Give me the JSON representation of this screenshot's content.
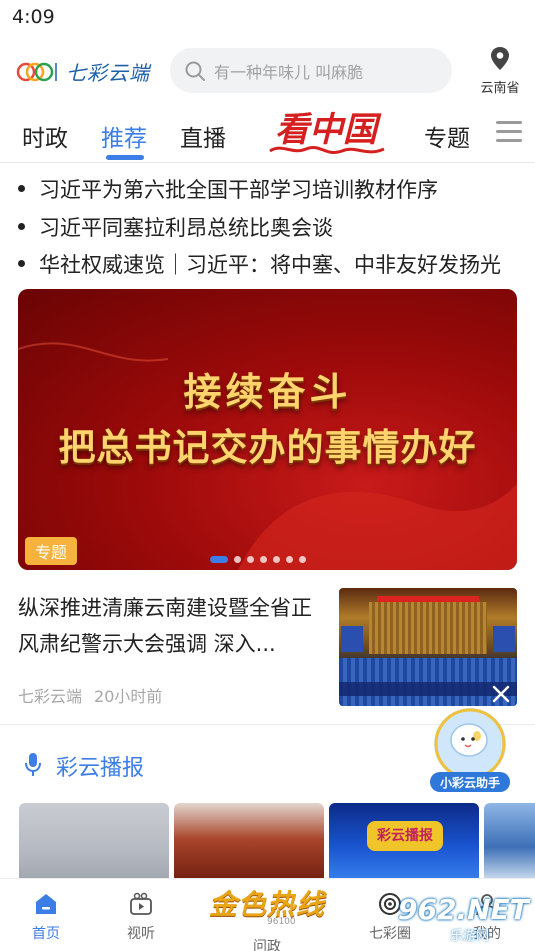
{
  "status_bar": {
    "time": "4:09"
  },
  "header": {
    "logo_text": "七彩云端",
    "search_placeholder": "有一种年味儿 叫麻脆",
    "location": "云南省"
  },
  "tabs": [
    {
      "label": "时政",
      "active": false
    },
    {
      "label": "推荐",
      "active": true
    },
    {
      "label": "直播",
      "active": false
    },
    {
      "label": "专题",
      "active": false
    }
  ],
  "center_tab_logo": "看中国",
  "headlines": [
    "习近平为第六批全国干部学习培训教材作序",
    "习近平同塞拉利昂总统比奥会谈",
    "华社权威速览｜习近平：将中塞、中非友好发扬光"
  ],
  "banner": {
    "line1": "接续奋斗",
    "line2": "把总书记交办的事情办好",
    "tag": "专题",
    "slide_count": 7,
    "active_slide": 0
  },
  "article": {
    "title": "纵深推进清廉云南建设暨全省正风肃纪警示大会强调 深入...",
    "source": "七彩云端",
    "time": "20小时前"
  },
  "assistant_label": "小彩云助手",
  "broadcast": {
    "title": "彩云播报",
    "thumb_badge": "彩云播报"
  },
  "bottom_nav": {
    "items": [
      {
        "label": "首页",
        "icon": "home-icon",
        "active": true
      },
      {
        "label": "视听",
        "icon": "video-icon",
        "active": false
      },
      {
        "label": "问政",
        "icon": "golden-hotline-logo",
        "active": false
      },
      {
        "label": "七彩圈",
        "icon": "circle-icon",
        "active": false
      },
      {
        "label": "我的",
        "icon": "user-icon",
        "active": false
      }
    ],
    "center_logo": "金色热线",
    "center_sub": "96100"
  },
  "watermark": {
    "logo": "962.NET",
    "sub": "乐游网"
  },
  "colors": {
    "accent": "#3d7ee6",
    "banner_red": "#b01010",
    "tag_orange": "#f6b23c"
  }
}
